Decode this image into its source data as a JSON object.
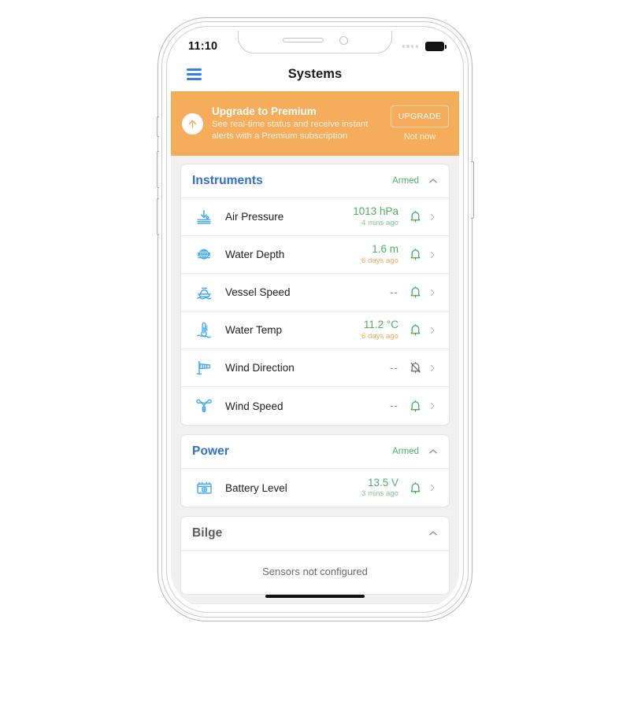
{
  "statusbar": {
    "time": "11:10",
    "signal_icon": "signal-dots-icon",
    "battery_icon": "battery-full-icon"
  },
  "navbar": {
    "menu_icon": "hamburger-menu-icon",
    "title": "Systems"
  },
  "promo": {
    "icon": "arrow-up-circle-icon",
    "title": "Upgrade to Premium",
    "subtitle": "See real-time status and receive instant alerts with a Premium subscription",
    "upgrade_label": "UPGRADE",
    "dismiss_label": "Not now",
    "background_color": "#f5ad5c"
  },
  "sections": [
    {
      "title": "Instruments",
      "status": "Armed",
      "collapse_icon": "chevron-up-icon",
      "rows": [
        {
          "icon": "air-pressure-icon",
          "label": "Air Pressure",
          "value": "1013 hPa",
          "ago": "4 mins ago",
          "ago_tone": "green",
          "bell": "bell-icon",
          "chevron": "chevron-right-icon"
        },
        {
          "icon": "water-depth-icon",
          "label": "Water Depth",
          "value": "1.6 m",
          "ago": "6 days ago",
          "ago_tone": "orange",
          "bell": "bell-icon",
          "chevron": "chevron-right-icon"
        },
        {
          "icon": "vessel-speed-icon",
          "label": "Vessel Speed",
          "value": "--",
          "ago": "",
          "ago_tone": "none",
          "bell": "bell-icon",
          "chevron": "chevron-right-icon"
        },
        {
          "icon": "water-temp-icon",
          "label": "Water Temp",
          "value": "11.2 °C",
          "ago": "6 days ago",
          "ago_tone": "orange",
          "bell": "bell-icon",
          "chevron": "chevron-right-icon"
        },
        {
          "icon": "wind-direction-icon",
          "label": "Wind Direction",
          "value": "--",
          "ago": "",
          "ago_tone": "none",
          "bell": "bell-off-icon",
          "chevron": "chevron-right-icon"
        },
        {
          "icon": "wind-speed-icon",
          "label": "Wind Speed",
          "value": "--",
          "ago": "",
          "ago_tone": "none",
          "bell": "bell-icon",
          "chevron": "chevron-right-icon"
        }
      ]
    },
    {
      "title": "Power",
      "status": "Armed",
      "collapse_icon": "chevron-up-icon",
      "rows": [
        {
          "icon": "battery-level-icon",
          "label": "Battery Level",
          "value": "13.5 V",
          "ago": "3 mins ago",
          "ago_tone": "green",
          "bell": "bell-icon",
          "chevron": "chevron-right-icon"
        }
      ]
    },
    {
      "title": "Bilge",
      "status": "",
      "collapse_icon": "chevron-up-icon",
      "empty_message": "Sensors not configured",
      "rows": []
    }
  ],
  "colors": {
    "accent_blue": "#2f80ed",
    "title_blue": "#2f6fd0",
    "armed_green": "#4cae64",
    "promo_orange": "#f5ad5c",
    "icon_blue": "#3fa9f5"
  },
  "home_indicator": "home-indicator"
}
